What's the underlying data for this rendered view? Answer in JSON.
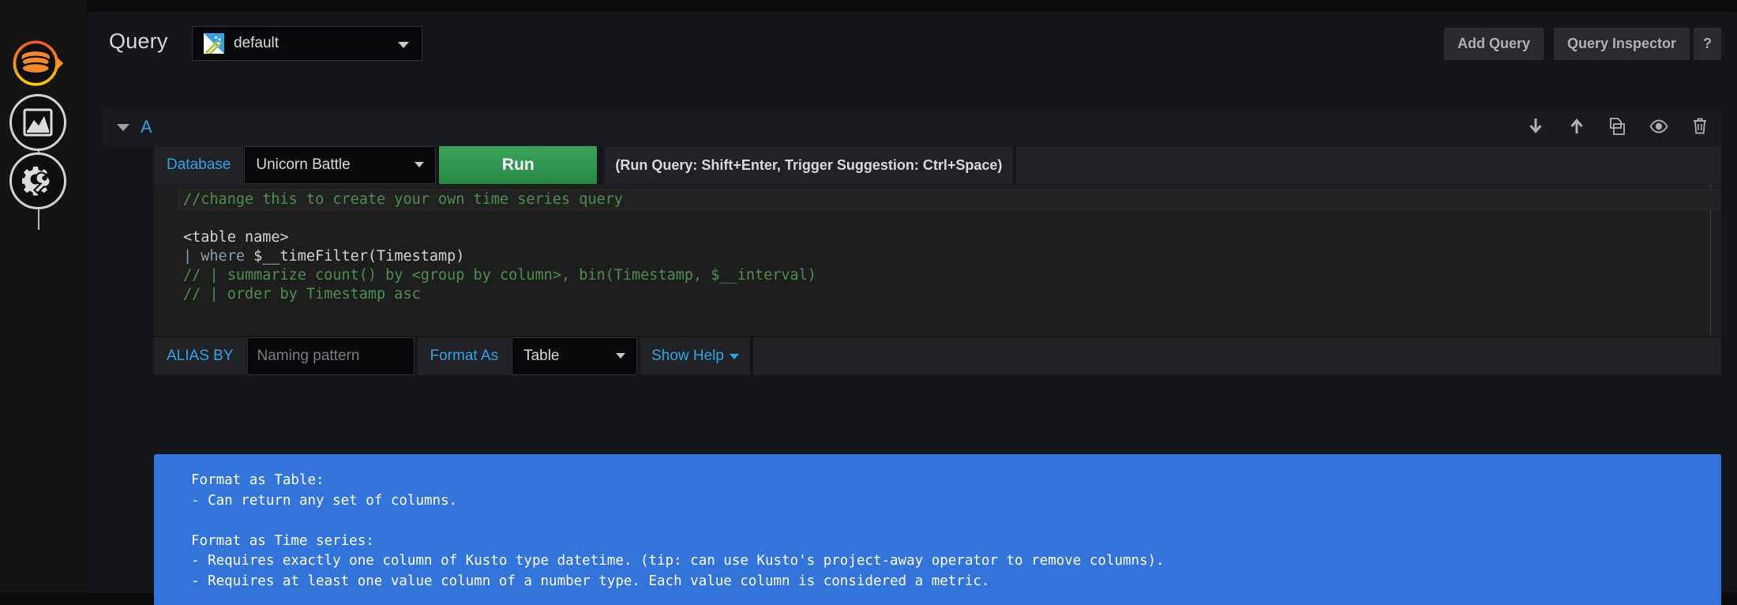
{
  "navrail": {
    "items": [
      {
        "name": "datasource-node",
        "icon": "database-icon",
        "active": true
      },
      {
        "name": "visualization-node",
        "icon": "graph-panel-icon",
        "active": false
      },
      {
        "name": "settings-node",
        "icon": "gear-wrench-icon",
        "active": false
      }
    ]
  },
  "header": {
    "title": "Query",
    "datasource": {
      "icon": "azure-data-explorer-icon",
      "value": "default",
      "caret": "chevron-down-icon"
    },
    "buttons": {
      "add_query": "Add Query",
      "query_inspector": "Query Inspector",
      "help": "?"
    }
  },
  "query_row": {
    "ref_id": "A",
    "collapse_icon": "chevron-down-icon",
    "actions": [
      {
        "name": "move-query-down-button",
        "icon": "arrow-down-icon"
      },
      {
        "name": "move-query-up-button",
        "icon": "arrow-up-icon"
      },
      {
        "name": "duplicate-query-button",
        "icon": "copy-icon"
      },
      {
        "name": "toggle-query-visibility-button",
        "icon": "eye-icon"
      },
      {
        "name": "remove-query-button",
        "icon": "trash-icon"
      }
    ]
  },
  "editor_toolbar": {
    "database_label": "Database",
    "database_value": "Unicorn Battle",
    "run_label": "Run",
    "run_hint": "(Run Query: Shift+Enter, Trigger Suggestion: Ctrl+Space)"
  },
  "code": {
    "lines": [
      [
        {
          "t": "//change this to create your own time series query",
          "c": "c-comment"
        }
      ],
      [],
      [
        {
          "t": "<table name>",
          "c": "c-text"
        }
      ],
      [
        {
          "t": "| ",
          "c": "c-pipe"
        },
        {
          "t": "where ",
          "c": "c-kw"
        },
        {
          "t": "$__timeFilter(Timestamp)",
          "c": "c-text"
        }
      ],
      [
        {
          "t": "// | summarize count() by <group by column>, bin(Timestamp, $__interval)",
          "c": "c-comment"
        }
      ],
      [
        {
          "t": "// | order by Timestamp asc",
          "c": "c-comment"
        }
      ]
    ],
    "current_line_index": 0
  },
  "bottom_toolbar": {
    "alias_label": "ALIAS BY",
    "alias_value": "",
    "alias_placeholder": "Naming pattern",
    "format_label": "Format As",
    "format_value": "Table",
    "show_help_label": "Show Help"
  },
  "help_panel": {
    "text": "Format as Table:\n- Can return any set of columns.\n\nFormat as Time series:\n- Requires exactly one column of Kusto type datetime. (tip: can use Kusto's project-away operator to remove columns).\n- Requires at least one value column of a number type. Each value column is considered a metric."
  },
  "colors": {
    "accent_blue": "#33a2e5",
    "run_green": "#278a44",
    "help_blue": "#3274d9",
    "active_orange": "#f2882e",
    "panel_bg": "#141619"
  }
}
